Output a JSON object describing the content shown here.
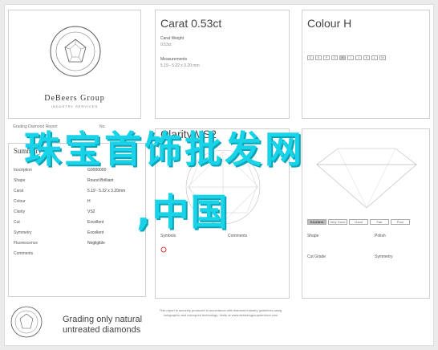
{
  "logo": {
    "brand": "DeBeers Group",
    "sub": "INDUSTRY SERVICES",
    "seal_text": "INSTITUTE OF DIAMONDS"
  },
  "carat": {
    "title": "Carat",
    "value": "0.53ct",
    "weight_label": "Carat Weight",
    "weight_value": "0.53ct",
    "meas_label": "Measurements",
    "meas_value": "5.19 - 5.22 x 3.20 mm"
  },
  "colour": {
    "title": "Colour",
    "grade": "H",
    "swatches": [
      "D",
      "E",
      "F",
      "G",
      "H",
      "I",
      "J",
      "K",
      "L",
      "M"
    ]
  },
  "summary": {
    "report_head": "Grading Diamond Report",
    "report_no": "No.",
    "heading": "Summary",
    "rows": [
      {
        "label": "Inscription",
        "value": "G0000000"
      },
      {
        "label": "Shape",
        "value": "Round Brilliant"
      },
      {
        "label": "Carat",
        "value": "5.19 - 5.22 x 3.20mm"
      },
      {
        "label": "Colour",
        "value": "H"
      },
      {
        "label": "Clarity",
        "value": "VS2"
      },
      {
        "label": "Cut",
        "value": "Excellent"
      },
      {
        "label": "Symmetry",
        "value": "Excellent"
      },
      {
        "label": "Fluorescence",
        "value": "Negligible"
      },
      {
        "label": "Comments",
        "value": ""
      }
    ]
  },
  "plot": {
    "title": "Clarity",
    "grade": "VS2",
    "symbols_label": "Symbols",
    "comments_label": "Comments"
  },
  "grade": {
    "cut_levels": [
      "Excellent",
      "Very Good",
      "Good",
      "Fair",
      "Poor"
    ],
    "polish_label": "Polish",
    "shape_label": "Shape",
    "cut_grade_label": "Cut Grade",
    "symmetry_label": "Symmetry"
  },
  "footer": {
    "line1": "Grading only natural",
    "line2": "untreated diamonds",
    "note": "This report is securely produced in accordance with diamond industry guidelines using holographic and microprint technology. Verify at www.debeersgroupservices.com"
  },
  "watermark": {
    "line1": "珠宝首饰批发网",
    "line2": ",中国"
  }
}
